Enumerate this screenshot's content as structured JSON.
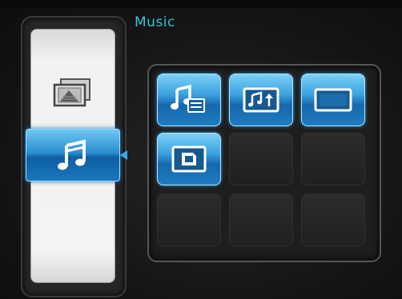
{
  "header": {
    "title": "Music"
  },
  "sidebar": {
    "items": [
      {
        "icon": "photo-slideshow-icon",
        "selected": false
      },
      {
        "icon": "music-note-icon",
        "selected": true
      }
    ]
  },
  "grid": {
    "tiles": [
      {
        "icon": "music-playlist-icon",
        "active": true
      },
      {
        "icon": "music-import-icon",
        "active": true
      },
      {
        "icon": "display-screen-icon",
        "active": true
      },
      {
        "icon": "memory-card-icon",
        "active": true
      },
      {
        "icon": null,
        "active": false
      },
      {
        "icon": null,
        "active": false
      },
      {
        "icon": null,
        "active": false
      },
      {
        "icon": null,
        "active": false
      },
      {
        "icon": null,
        "active": false
      }
    ]
  },
  "colors": {
    "accent": "#2fc6d8",
    "highlight": "#2b8fd0",
    "background": "#161616"
  }
}
